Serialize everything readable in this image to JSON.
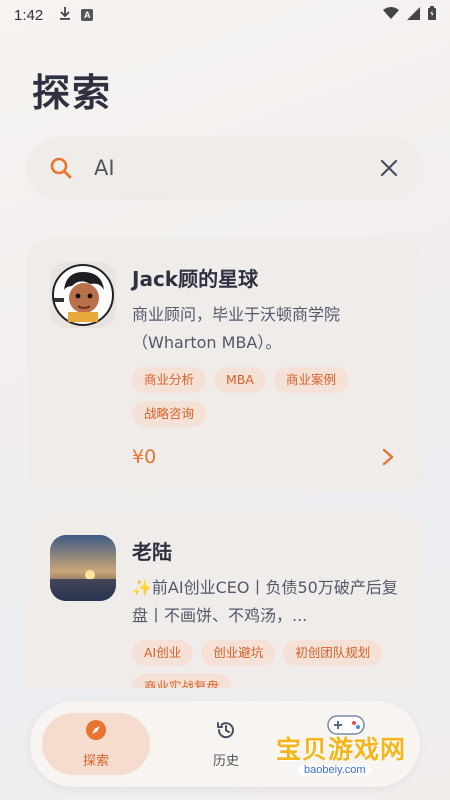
{
  "status_bar": {
    "time": "1:42",
    "a_badge": "A",
    "icons": [
      "download-icon",
      "a-badge-icon",
      "wifi-icon",
      "signal-icon",
      "battery-icon"
    ]
  },
  "page": {
    "title": "探索"
  },
  "search": {
    "value": "AI",
    "placeholder": ""
  },
  "results": [
    {
      "name": "Jack顾的星球",
      "description": "商业顾问，毕业于沃顿商学院（Wharton MBA）。",
      "tags": [
        "商业分析",
        "MBA",
        "商业案例",
        "战略咨询"
      ],
      "price": "¥0"
    },
    {
      "name": "老陆",
      "description": "✨前AI创业CEO丨负债50万破产后复盘丨不画饼、不鸡汤，...",
      "tags": [
        "AI创业",
        "创业避坑",
        "初创团队规划",
        "商业实战复盘"
      ]
    }
  ],
  "tabbar": {
    "tabs": [
      {
        "label": "探索",
        "icon": "compass-icon",
        "active": true
      },
      {
        "label": "历史",
        "icon": "history-icon",
        "active": false
      }
    ]
  },
  "watermark": {
    "text": "宝贝游戏网",
    "url": "baobeiy.com"
  },
  "colors": {
    "accent": "#e8742f",
    "tag_bg": "#f6e1d6",
    "tag_text": "#d4612a",
    "card_bg": "#f0ecea",
    "title": "#2f3140"
  }
}
